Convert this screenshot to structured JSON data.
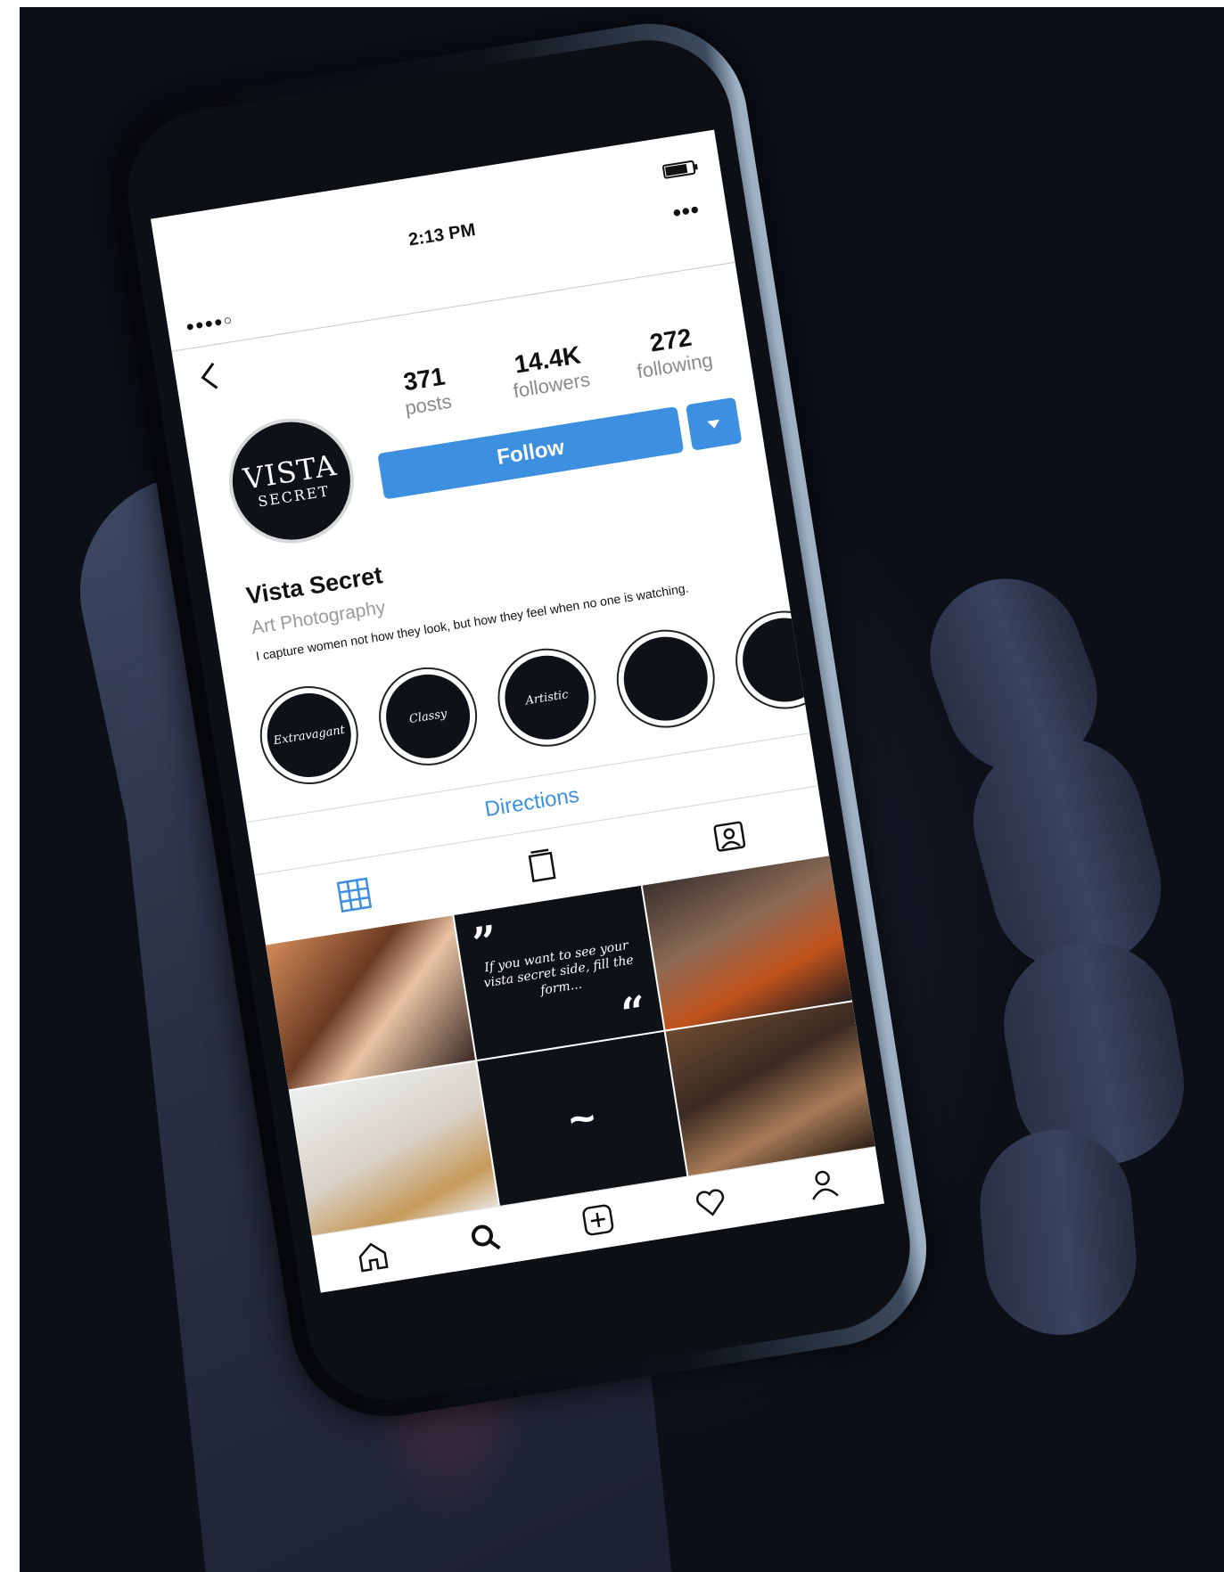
{
  "status_bar": {
    "signal": "●●●●○",
    "time": "2:13 PM",
    "more": "•••"
  },
  "profile": {
    "avatar": {
      "line1": "VISTA",
      "line2": "SECRET"
    },
    "stats": [
      {
        "number": "371",
        "label": "posts"
      },
      {
        "number": "14.4K",
        "label": "followers"
      },
      {
        "number": "272",
        "label": "following"
      }
    ],
    "follow_label": "Follow",
    "username": "Vista Secret",
    "category": "Art Photography",
    "bio": "I capture women not how they look, but how they feel when no one is watching."
  },
  "highlights": [
    {
      "label": "Extravagant"
    },
    {
      "label": "Classy"
    },
    {
      "label": "Artistic"
    },
    {
      "label": ""
    },
    {
      "label": ""
    }
  ],
  "directions_label": "Directions",
  "tabs": [
    "grid-icon",
    "feed-icon",
    "tagged-icon"
  ],
  "posts": {
    "quote_text": "If you want to see your vista secret side, fill the form...",
    "quote_open": "”",
    "quote_close": "“",
    "tilde_tile": "~"
  },
  "bottom_nav": [
    "home-icon",
    "search-icon",
    "add-post-icon",
    "heart-icon",
    "profile-icon"
  ],
  "colors": {
    "accent": "#3d8fe0",
    "dark": "#0e1116"
  }
}
